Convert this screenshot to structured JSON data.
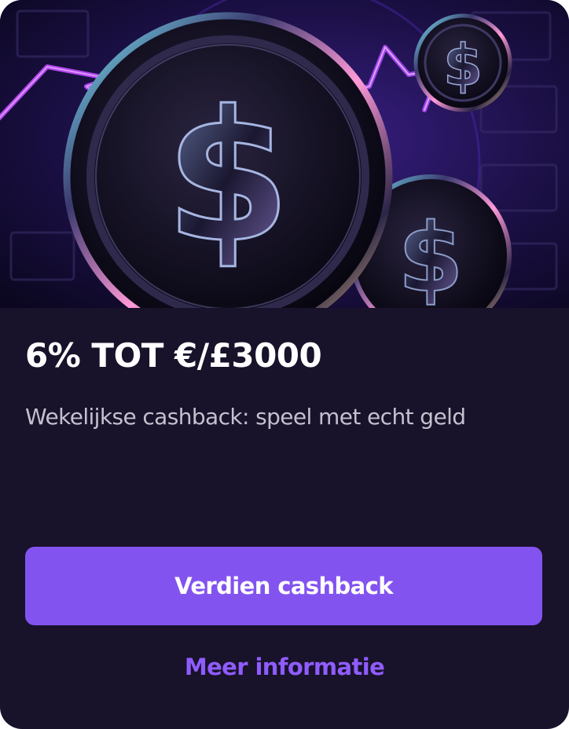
{
  "hero": {
    "image": "cashback-coins-illustration",
    "icon": "dollar-coin-icon"
  },
  "promo": {
    "title": "6% TOT €/£3000",
    "subtitle": "Wekelijkse cashback: speel met echt geld"
  },
  "actions": {
    "primary_label": "Verdien cashback",
    "secondary_label": "Meer informatie"
  },
  "colors": {
    "card_background": "#18122a",
    "accent": "#8353f0",
    "link": "#8f5cff",
    "title": "#ffffff",
    "subtitle": "#c4c1cf"
  }
}
